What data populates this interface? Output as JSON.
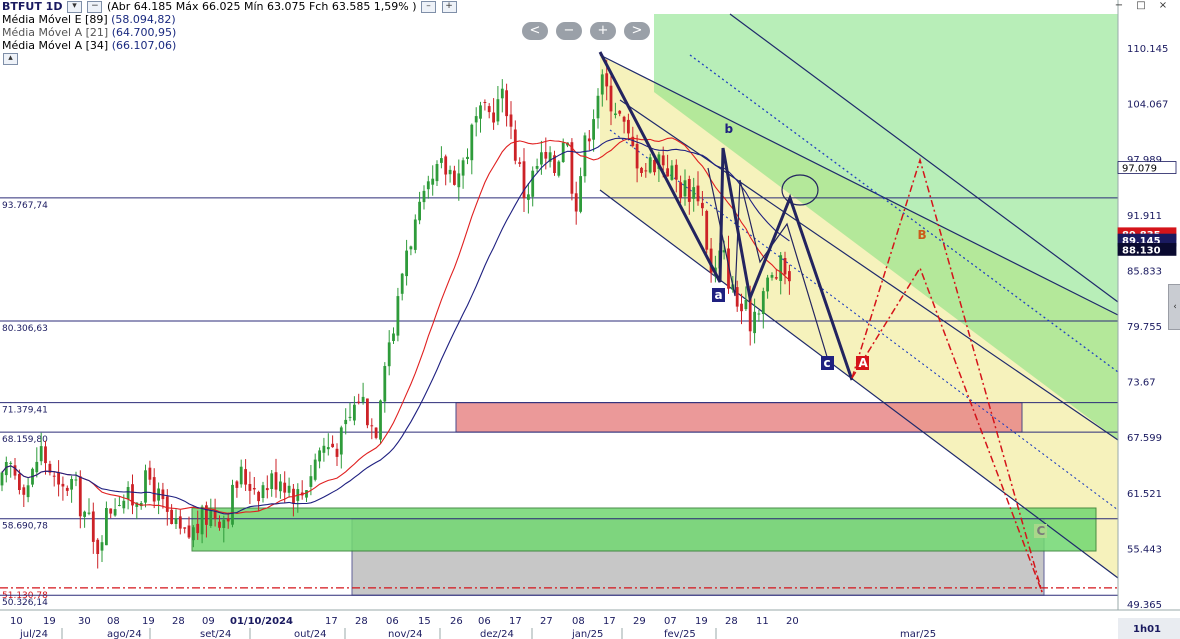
{
  "header": {
    "symbol": "BTFUT 1D",
    "ohlc": "(Abr 64.185 Máx 66.025 Mín 63.075 Fch 63.585 1,59% )",
    "ma_lines": [
      {
        "label": "Média Móvel E [89]",
        "value": "(58.094,82)"
      },
      {
        "label": "Média Móvel A [21]",
        "value": "(64.700,95)"
      },
      {
        "label": "Média Móvel A [34]",
        "value": "(66.107,06)"
      }
    ]
  },
  "zoom_buttons": [
    "<",
    "−",
    "+",
    ">"
  ],
  "window_buttons": [
    "−",
    "□",
    "×"
  ],
  "chart_data": {
    "type": "candlestick",
    "ylim": [
      48000,
      114000
    ],
    "y_ticks": [
      {
        "value": 110145,
        "label": "110.145"
      },
      {
        "value": 104067,
        "label": "104.067"
      },
      {
        "value": 97989,
        "label": "97.989"
      },
      {
        "value": 91911,
        "label": "91.911"
      },
      {
        "value": 85833,
        "label": "85.833"
      },
      {
        "value": 79755,
        "label": "79.755"
      },
      {
        "value": 73677,
        "label": "73.67"
      },
      {
        "value": 67599,
        "label": "67.599"
      },
      {
        "value": 61521,
        "label": "61.521"
      },
      {
        "value": 55443,
        "label": "55.443"
      },
      {
        "value": 49365,
        "label": "49.365"
      }
    ],
    "price_tags": [
      {
        "value": 97079,
        "label": "97.079",
        "color": "#ffffff",
        "text": "#000000"
      },
      {
        "value": 89835,
        "label": "89.835",
        "color": "#d4141a",
        "text": "#ffffff"
      },
      {
        "value": 89145,
        "label": "89.145",
        "color": "#1a1a60",
        "text": "#ffffff"
      },
      {
        "value": 88130,
        "label": "88.130",
        "color": "#0a0a30",
        "text": "#ffffff"
      }
    ],
    "h_levels": [
      {
        "value": 93767.74,
        "label": "93.767,74",
        "style": "solid",
        "color": "#2b2b78"
      },
      {
        "value": 80306.63,
        "label": "80.306,63",
        "style": "solid",
        "color": "#2b2b78"
      },
      {
        "value": 71379.41,
        "label": "71.379,41",
        "style": "solid",
        "color": "#2b2b78"
      },
      {
        "value": 68159.8,
        "label": "68.159,80",
        "style": "solid",
        "color": "#2b2b78"
      },
      {
        "value": 58690.78,
        "label": "58.690,78",
        "style": "solid",
        "color": "#2b2b78"
      },
      {
        "value": 51130.78,
        "label": "51.130,78",
        "style": "dashdot",
        "color": "#d4141a"
      },
      {
        "value": 50326.14,
        "label": "50.326,14",
        "style": "solid",
        "color": "#2b2b78"
      }
    ],
    "x_day_labels": [
      "10",
      "19",
      "30",
      "08",
      "19",
      "28",
      "09",
      "01/10/2024",
      "17",
      "28",
      "06",
      "15",
      "26",
      "06",
      "17",
      "27",
      "08",
      "17",
      "29",
      "07",
      "19",
      "28",
      "11",
      "20"
    ],
    "x_month_labels": [
      "jul/24",
      "ago/24",
      "set/24",
      "out/24",
      "nov/24",
      "dez/24",
      "jan/25",
      "fev/25",
      "mar/25"
    ],
    "footer_interval": "1h01",
    "wave_labels": [
      "a",
      "b",
      "c",
      "A",
      "B",
      "C"
    ],
    "colors": {
      "bull": "#2e9b3a",
      "bear": "#cc2227",
      "ma21": "#e02020",
      "ma34": "#1f2080",
      "channel": "#1f2a6b",
      "fib_dotted": "#2040c0",
      "green_zone": "#7ee07e",
      "yellow_zone": "#f5f0b0",
      "red_zone": "#e88888",
      "gray_zone": "#b5b5b5",
      "projection": "#d4141a"
    }
  }
}
